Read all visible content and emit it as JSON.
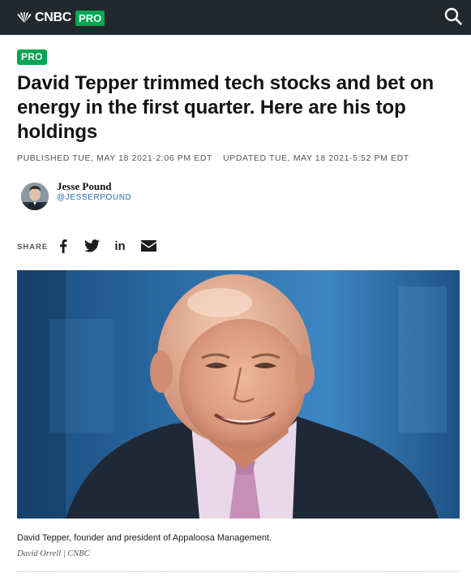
{
  "header": {
    "logo_text": "CNBC",
    "logo_pro": "PRO",
    "search_icon": "search-icon"
  },
  "article": {
    "badge": "PRO",
    "headline": "David Tepper trimmed tech stocks and bet on energy in the first quarter. Here are his top holdings",
    "published": "PUBLISHED TUE, MAY 18 2021·2:06 PM EDT",
    "updated": "UPDATED TUE, MAY 18 2021·5:52 PM EDT"
  },
  "author": {
    "name": "Jesse Pound",
    "handle": "@JESSERPOUND"
  },
  "share": {
    "label": "SHARE",
    "icons": [
      "facebook-icon",
      "twitter-icon",
      "linkedin-icon",
      "email-icon"
    ],
    "linkedin_text": "in"
  },
  "image": {
    "caption": "David Tepper, founder and president of Appaloosa Management.",
    "credit": "David Orrell | CNBC"
  },
  "colors": {
    "topbar": "#23282d",
    "pro_green": "#00a651",
    "handle_blue": "#2a6db5"
  }
}
